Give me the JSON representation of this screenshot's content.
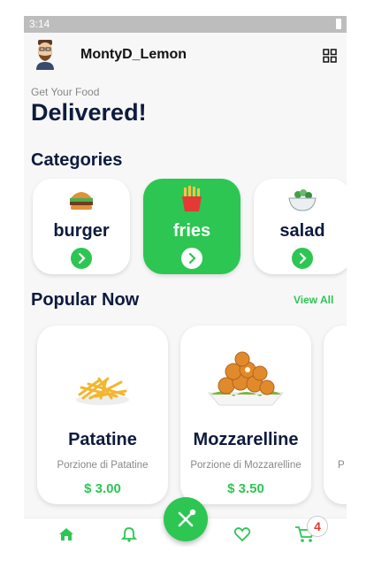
{
  "status_bar": {
    "time": "3:14"
  },
  "header": {
    "username": "MontyD_Lemon"
  },
  "hero": {
    "subtitle": "Get Your Food",
    "headline": "Delivered!"
  },
  "categories": {
    "title": "Categories",
    "items": [
      {
        "label": "burger",
        "icon": "burger-icon",
        "active": false
      },
      {
        "label": "fries",
        "icon": "fries-icon",
        "active": true
      },
      {
        "label": "salad",
        "icon": "salad-icon",
        "active": false
      }
    ]
  },
  "popular": {
    "title": "Popular Now",
    "view_all": "View All",
    "items": [
      {
        "name": "Patatine",
        "description": "Porzione di Patatine",
        "price": "$ 3.00"
      },
      {
        "name": "Mozzarelline",
        "description": "Porzione di Mozzarelline",
        "price": "$ 3.50"
      },
      {
        "name": "",
        "description": "P",
        "price": ""
      }
    ]
  },
  "cart": {
    "count": "4"
  },
  "colors": {
    "accent": "#2dc653",
    "heading": "#0d1b3e",
    "badge": "#e53935"
  }
}
